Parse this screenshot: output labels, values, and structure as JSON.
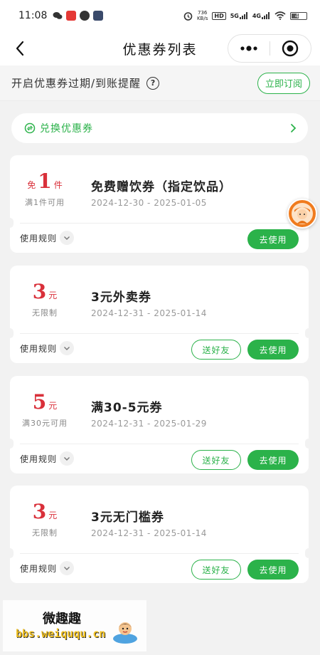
{
  "status_bar": {
    "time": "11:08",
    "speed_value": "736",
    "speed_unit": "KB/s",
    "net_tag_1": "HD",
    "net_tag_2": "5G",
    "net_tag_3": "4G",
    "battery": "40"
  },
  "nav": {
    "title": "优惠券列表"
  },
  "subscribe": {
    "text": "开启优惠券过期/到账提醒",
    "button": "立即订阅"
  },
  "redeem": {
    "label": "兑换优惠券"
  },
  "coupons": [
    {
      "prefix": "免",
      "amount": "1",
      "unit": "件",
      "condition": "满1件可用",
      "name": "免费赠饮券（指定饮品）",
      "date": "2024-12-30 - 2025-01-05",
      "rules": "使用规则",
      "use": "去使用"
    },
    {
      "prefix": "",
      "amount": "3",
      "unit": "元",
      "condition": "无限制",
      "name": "3元外卖券",
      "date": "2024-12-31 - 2025-01-14",
      "rules": "使用规则",
      "share": "送好友",
      "use": "去使用"
    },
    {
      "prefix": "",
      "amount": "5",
      "unit": "元",
      "condition": "满30元可用",
      "name": "满30-5元券",
      "date": "2024-12-31 - 2025-01-29",
      "rules": "使用规则",
      "share": "送好友",
      "use": "去使用"
    },
    {
      "prefix": "",
      "amount": "3",
      "unit": "元",
      "condition": "无限制",
      "name": "3元无门槛券",
      "date": "2024-12-31 - 2025-01-14",
      "rules": "使用规则",
      "share": "送好友",
      "use": "去使用"
    }
  ],
  "watermark": {
    "title": "微趣趣",
    "url": "bbs.weiququ.cn"
  },
  "colors": {
    "accent": "#2bb24a",
    "price": "#d9303a",
    "background": "#f2f2f2"
  },
  "icons": {
    "back": "chevron-left-icon",
    "more": "more-dots-icon",
    "close_miniprogram": "target-circle-icon",
    "help": "question-circle-icon",
    "redeem": "exchange-icon",
    "chevron": "chevron-right-icon",
    "rules_toggle": "chevron-down-icon"
  }
}
